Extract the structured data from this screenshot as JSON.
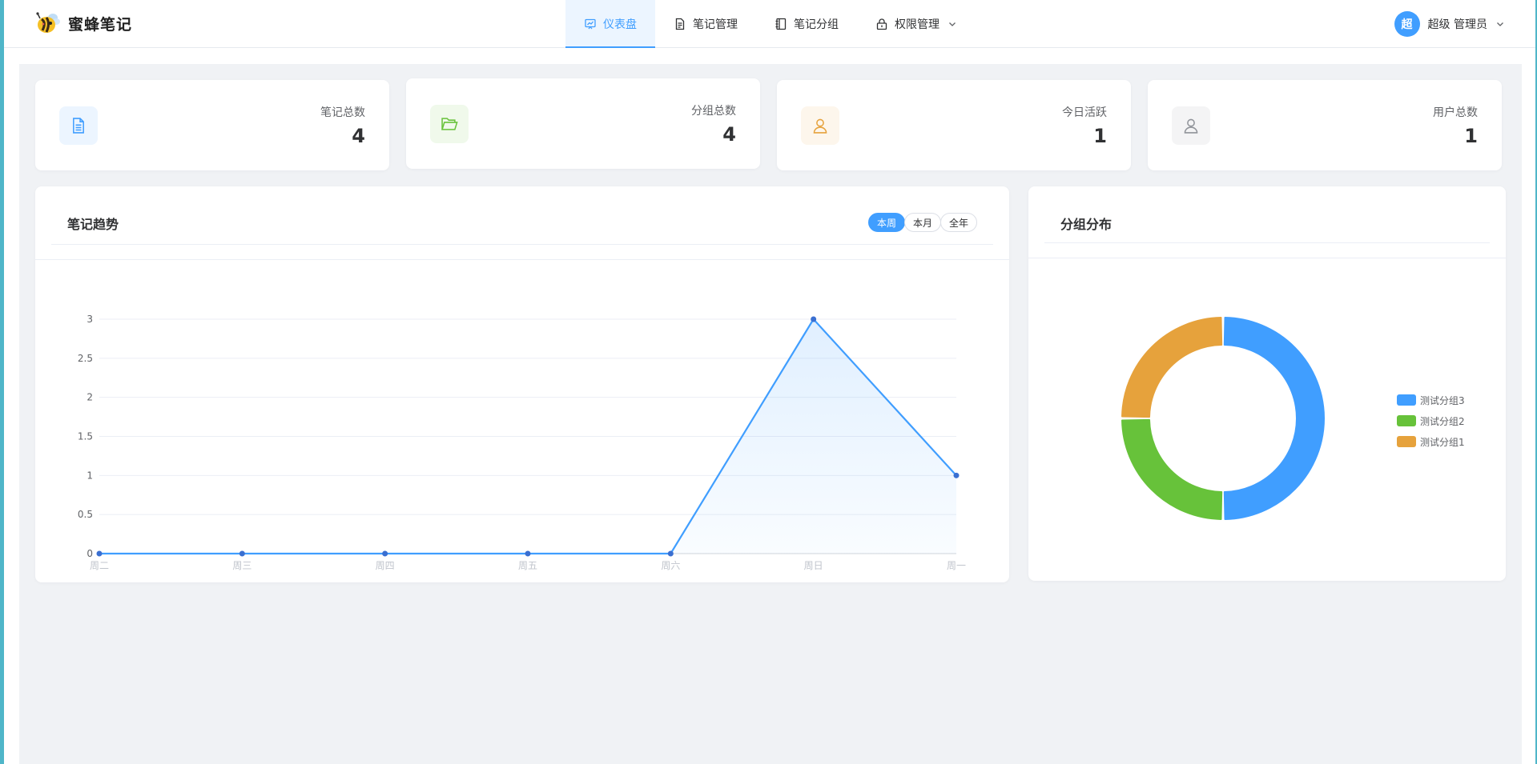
{
  "app": {
    "name": "蜜蜂笔记"
  },
  "nav": [
    {
      "label": "仪表盘",
      "icon": "chart-icon",
      "active": true
    },
    {
      "label": "笔记管理",
      "icon": "document-icon",
      "active": false
    },
    {
      "label": "笔记分组",
      "icon": "notebook-icon",
      "active": false
    },
    {
      "label": "权限管理",
      "icon": "lock-icon",
      "active": false,
      "dropdown": true
    }
  ],
  "user": {
    "avatar_text": "超",
    "name": "超级 管理员"
  },
  "stats": [
    {
      "label": "笔记总数",
      "value": "4",
      "icon": "document-icon",
      "color": "#409eff",
      "bg": "#ecf5ff"
    },
    {
      "label": "分组总数",
      "value": "4",
      "icon": "folder-open-icon",
      "color": "#67c23a",
      "bg": "#f0f9eb"
    },
    {
      "label": "今日活跃",
      "value": "1",
      "icon": "user-icon",
      "color": "#e6a23c",
      "bg": "#fdf6ec"
    },
    {
      "label": "用户总数",
      "value": "1",
      "icon": "user-icon",
      "color": "#909399",
      "bg": "#f4f4f5"
    }
  ],
  "trend": {
    "title": "笔记趋势",
    "ranges": [
      {
        "label": "本周",
        "active": true
      },
      {
        "label": "本月",
        "active": false
      },
      {
        "label": "全年",
        "active": false
      }
    ]
  },
  "distribution": {
    "title": "分组分布"
  },
  "chart_data": [
    {
      "type": "line",
      "title": "笔记趋势",
      "categories": [
        "周二",
        "周三",
        "周四",
        "周五",
        "周六",
        "周日",
        "周一"
      ],
      "values": [
        0,
        0,
        0,
        0,
        0,
        3,
        1
      ],
      "y_ticks": [
        "0",
        "0.5",
        "1",
        "1.5",
        "2",
        "2.5",
        "3"
      ],
      "ylim": [
        0,
        3
      ],
      "area_fill": true,
      "grid": true,
      "color": "#409eff"
    },
    {
      "type": "pie",
      "title": "分组分布",
      "donut": true,
      "legend_position": "right",
      "series": [
        {
          "name": "测试分组3",
          "value": 2,
          "color": "#409eff"
        },
        {
          "name": "测试分组2",
          "value": 1,
          "color": "#67c23a"
        },
        {
          "name": "测试分组1",
          "value": 1,
          "color": "#e6a23c"
        }
      ]
    }
  ]
}
